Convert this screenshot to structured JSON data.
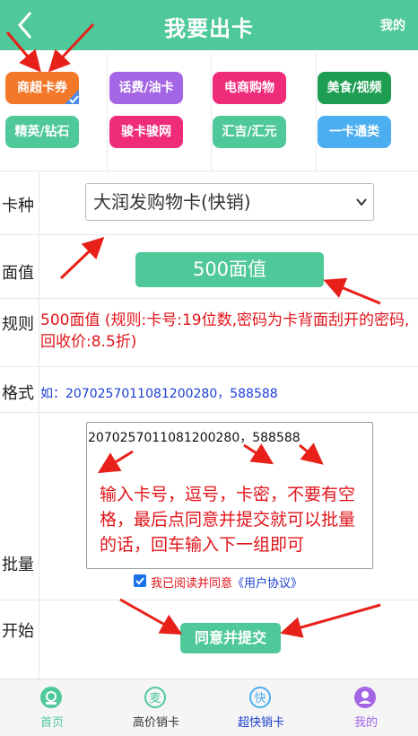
{
  "header": {
    "title": "我要出卡",
    "mine_label": "我的"
  },
  "categories": [
    {
      "label": "商超卡券",
      "color": "#f4782a",
      "selected": true
    },
    {
      "label": "话费/油卡",
      "color": "#a466e5"
    },
    {
      "label": "电商购物",
      "color": "#ee2c7a"
    },
    {
      "label": "美食/视频",
      "color": "#1e9e52"
    },
    {
      "label": "精英/钻石",
      "color": "#4fc89a"
    },
    {
      "label": "骏卡骏网",
      "color": "#ee2c7a"
    },
    {
      "label": "汇吉/汇元",
      "color": "#4fc89a"
    },
    {
      "label": "一卡通类",
      "color": "#4aaef0"
    }
  ],
  "form": {
    "card_type_label": "卡种",
    "card_type_value": "大润发购物卡(快销)",
    "denom_label": "面值",
    "denom_value": "500面值",
    "rule_label": "规则",
    "rule_text": "500面值 (规则:卡号:19位数,密码为卡背面刮开的密码,回收价:8.5折)",
    "format_label": "格式",
    "format_text": "如：2070257011081200280，588588",
    "batch_label": "批量",
    "batch_value": "2070257011081200280，588588",
    "batch_hint": "输入卡号，逗号，卡密，不要有空格，最后点同意并提交就可以批量的话，回车输入下一组即可",
    "agree_text": "我已阅读并同意",
    "agree_link": "《用户协议》",
    "start_label": "开始",
    "submit_label": "同意并提交"
  },
  "tabs": [
    {
      "label": "首页",
      "icon": "home-icon",
      "color": "#4fc89a",
      "active": true
    },
    {
      "label": "高价销卡",
      "icon": "mai-icon",
      "color": "#4fc89a",
      "active": true
    },
    {
      "label": "超快销卡",
      "icon": "kuai-icon",
      "color": "#4aaef0"
    },
    {
      "label": "我的",
      "icon": "user-icon",
      "color": "#a466e5"
    }
  ],
  "tab_icon_glyphs": {
    "mai": "麦",
    "kuai": "快"
  }
}
